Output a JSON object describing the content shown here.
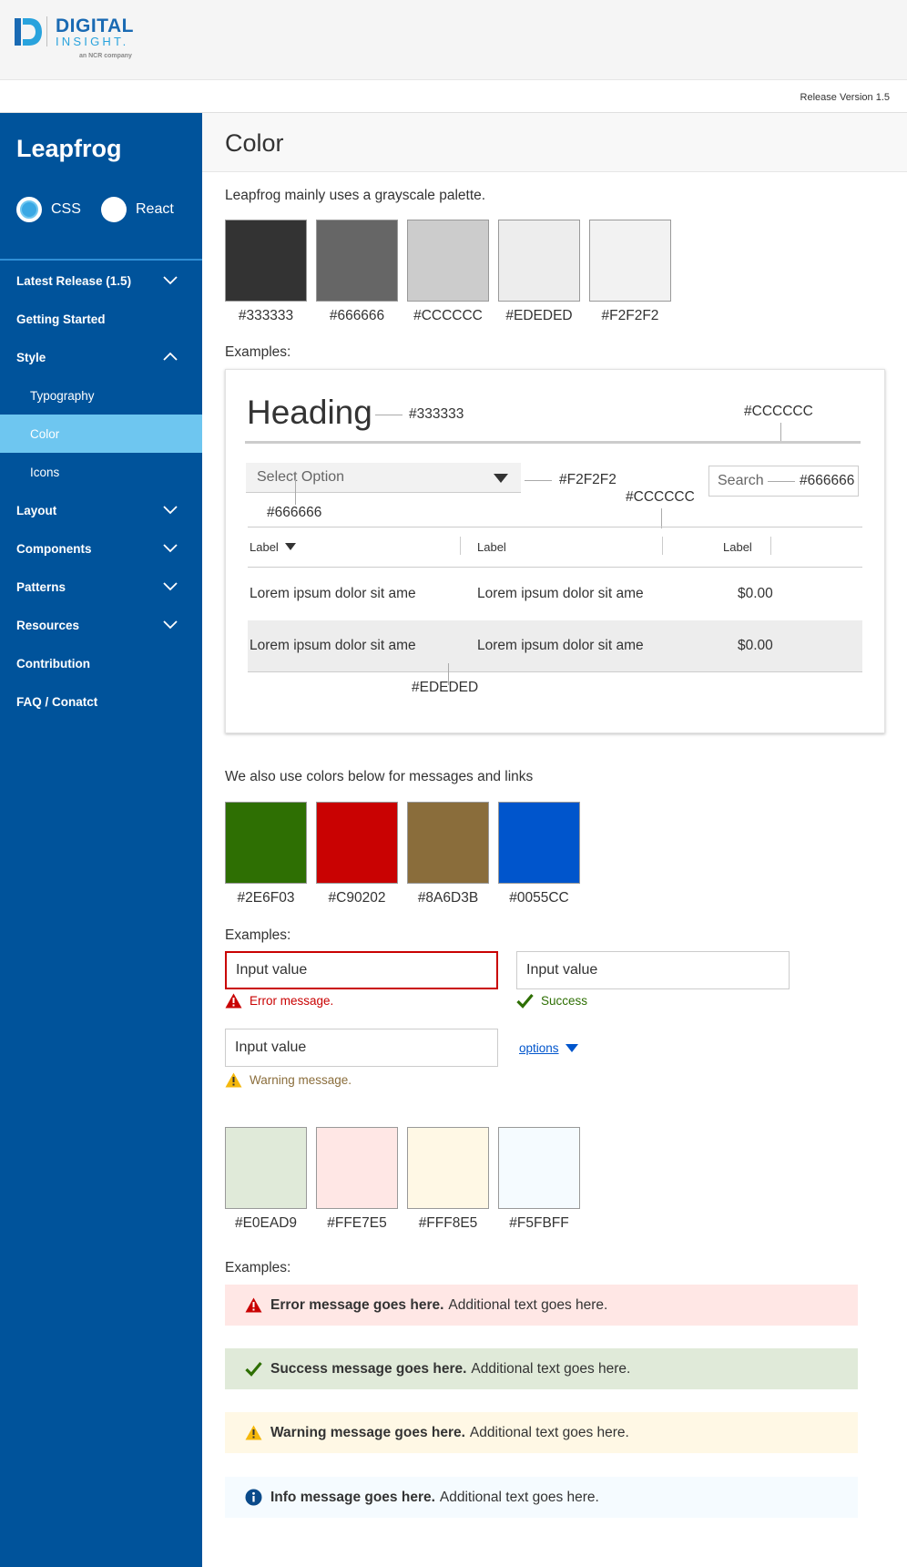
{
  "header": {
    "logo_line1": "DIGITAL",
    "logo_line2": "INSIGHT.",
    "logo_line3": "an NCR company",
    "release": "Release Version 1.5"
  },
  "sidebar": {
    "brand": "Leapfrog",
    "modes": [
      {
        "label": "CSS",
        "selected": true
      },
      {
        "label": "React",
        "selected": false
      }
    ],
    "items": [
      {
        "label": "Latest Release (1.5)",
        "chevron": "down"
      },
      {
        "label": "Getting Started"
      },
      {
        "label": "Style",
        "chevron": "up"
      },
      {
        "label": "Typography"
      },
      {
        "label": "Color",
        "active": true
      },
      {
        "label": "Icons"
      },
      {
        "label": "Layout",
        "chevron": "down"
      },
      {
        "label": "Components",
        "chevron": "down"
      },
      {
        "label": "Patterns",
        "chevron": "down"
      },
      {
        "label": "Resources",
        "chevron": "down"
      },
      {
        "label": "Contribution"
      },
      {
        "label": "FAQ / Conatct"
      }
    ]
  },
  "page": {
    "title": "Color",
    "intro": "Leapfrog mainly uses a grayscale palette.",
    "examples_label": "Examples:",
    "messages_intro": "We also use colors below for messages and links"
  },
  "grayscale": [
    "#333333",
    "#666666",
    "#CCCCCC",
    "#EDEDED",
    "#F2F2F2"
  ],
  "message_colors": [
    "#2E6F03",
    "#C90202",
    "#8A6D3B",
    "#0055CC"
  ],
  "background_colors": [
    "#E0EAD9",
    "#FFE7E5",
    "#FFF8E5",
    "#F5FBFF"
  ],
  "example": {
    "heading": "Heading",
    "heading_color": "#333333",
    "rule_color": "#CCCCCC",
    "select_placeholder": "Select Option",
    "select_bg": "#F2F2F2",
    "select_text_color": "#666666",
    "search_placeholder": "Search",
    "search_text_color": "#666666",
    "table_border_color": "#CCCCCC",
    "columns": [
      "Label",
      "Label",
      "Label"
    ],
    "rows": [
      [
        "Lorem ipsum dolor sit ame",
        "Lorem ipsum dolor sit ame",
        "$0.00"
      ],
      [
        "Lorem ipsum dolor sit ame",
        "Lorem ipsum dolor sit ame",
        "$0.00"
      ]
    ],
    "row_highlight_color": "#EDEDED"
  },
  "forms": {
    "error_input": "Input value",
    "error_msg": "Error message.",
    "success_input": "Input value",
    "success_msg": "Success",
    "warning_input": "Input value",
    "warning_msg": "Warning message.",
    "options_link": "options"
  },
  "banners": [
    {
      "type": "error",
      "bold": "Error message goes here.",
      "text": "Additional text goes here."
    },
    {
      "type": "success",
      "bold": "Success message goes here.",
      "text": "Additional text goes here."
    },
    {
      "type": "warning",
      "bold": "Warning message goes here.",
      "text": "Additional text goes here."
    },
    {
      "type": "info",
      "bold": "Info message goes here.",
      "text": "Additional text goes here."
    }
  ]
}
